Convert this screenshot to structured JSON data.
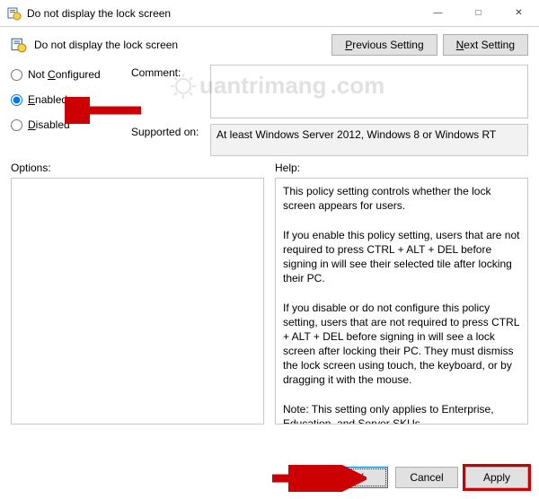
{
  "window": {
    "title": "Do not display the lock screen"
  },
  "header": {
    "title": "Do not display the lock screen",
    "prev_btn": "Previous Setting",
    "next_btn": "Next Setting"
  },
  "radios": {
    "not_configured": "Not Configured",
    "enabled": "Enabled",
    "disabled": "Disabled",
    "selected": "enabled"
  },
  "labels": {
    "comment": "Comment:",
    "supported_on": "Supported on:",
    "options": "Options:",
    "help": "Help:"
  },
  "fields": {
    "comment_value": "",
    "supported_text": "At least Windows Server 2012, Windows 8 or Windows RT"
  },
  "help_text": "This policy setting controls whether the lock screen appears for users.\n\nIf you enable this policy setting, users that are not required to press CTRL + ALT + DEL before signing in will see their selected tile after locking their PC.\n\nIf you disable or do not configure this policy setting, users that are not required to press CTRL + ALT + DEL before signing in will see a lock screen after locking their PC. They must dismiss the lock screen using touch, the keyboard, or by dragging it with the mouse.\n\nNote: This setting only applies to Enterprise, Education, and Server SKUs.",
  "footer": {
    "ok": "OK",
    "cancel": "Cancel",
    "apply": "Apply"
  },
  "watermark": "uantrimang",
  "colors": {
    "highlight": "#cc0000",
    "accent": "#0078d7"
  }
}
